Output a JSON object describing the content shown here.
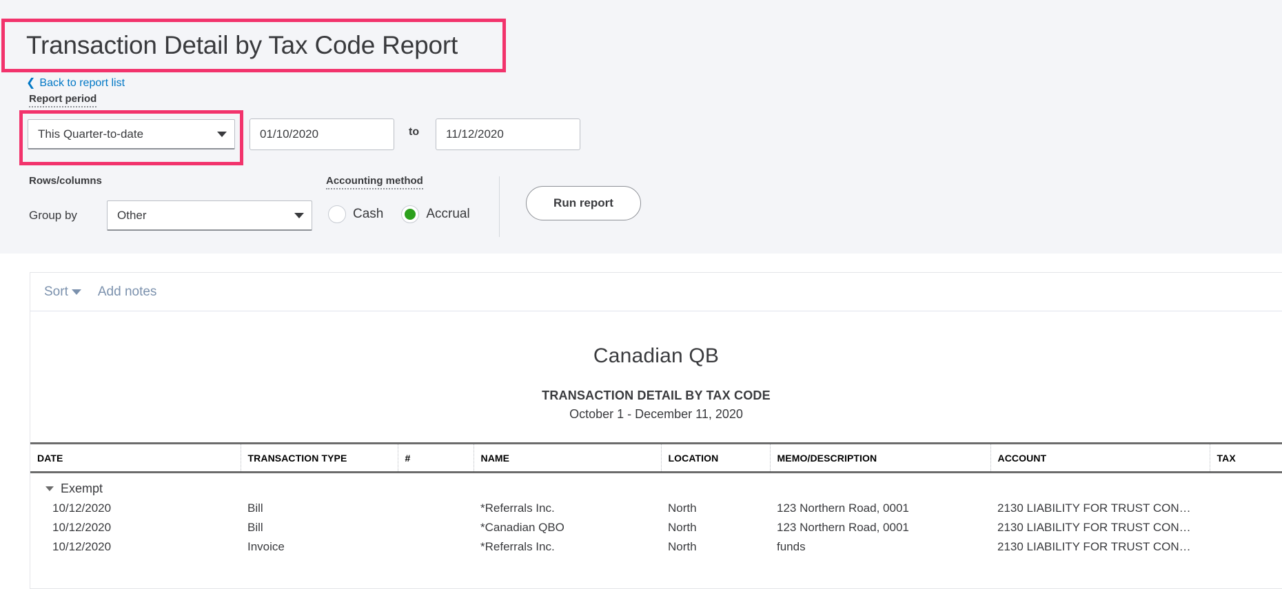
{
  "page": {
    "title": "Transaction Detail by Tax Code Report",
    "back_link": "Back to report list",
    "back_icon": "chevron-left-icon"
  },
  "filters": {
    "report_period_label": "Report period",
    "report_period_value": "This Quarter-to-date",
    "date_from": "01/10/2020",
    "date_to": "11/12/2020",
    "to_label": "to",
    "rows_columns_label": "Rows/columns",
    "group_by_label": "Group by",
    "group_by_value": "Other",
    "accounting_method_label": "Accounting method",
    "accounting_options": [
      {
        "label": "Cash",
        "selected": false
      },
      {
        "label": "Accrual",
        "selected": true
      }
    ],
    "run_report_label": "Run report",
    "dropdown_icon": "chevron-down-icon"
  },
  "toolbar": {
    "sort_label": "Sort",
    "sort_icon": "chevron-down-icon",
    "add_notes_label": "Add notes"
  },
  "report": {
    "company": "Canadian QB",
    "title": "TRANSACTION DETAIL BY TAX CODE",
    "date_range": "October 1 - December 11, 2020",
    "columns": [
      "DATE",
      "TRANSACTION TYPE",
      "#",
      "NAME",
      "LOCATION",
      "MEMO/DESCRIPTION",
      "ACCOUNT",
      "TAX"
    ],
    "groups": [
      {
        "name": "Exempt",
        "expanded": true,
        "collapse_icon": "triangle-down-icon",
        "rows": [
          {
            "date": "10/12/2020",
            "transaction_type": "Bill",
            "num": "",
            "name": "*Referrals Inc.",
            "location": "North",
            "memo": "123 Northern Road, 0001",
            "account": "2130 LIABILITY FOR TRUST CON…",
            "tax": ""
          },
          {
            "date": "10/12/2020",
            "transaction_type": "Bill",
            "num": "",
            "name": "*Canadian QBO",
            "location": "North",
            "memo": "123 Northern Road, 0001",
            "account": "2130 LIABILITY FOR TRUST CON…",
            "tax": ""
          },
          {
            "date": "10/12/2020",
            "transaction_type": "Invoice",
            "num": "",
            "name": "*Referrals Inc.",
            "location": "North",
            "memo": "funds",
            "account": "2130 LIABILITY FOR TRUST CON…",
            "tax": ""
          }
        ]
      }
    ]
  },
  "colors": {
    "highlight": "#f2336c",
    "link": "#0077c5",
    "accent_green": "#2ca01c",
    "panel_bg": "#f4f5f8",
    "text": "#393a3d",
    "toolbar_text": "#7b91ad"
  }
}
